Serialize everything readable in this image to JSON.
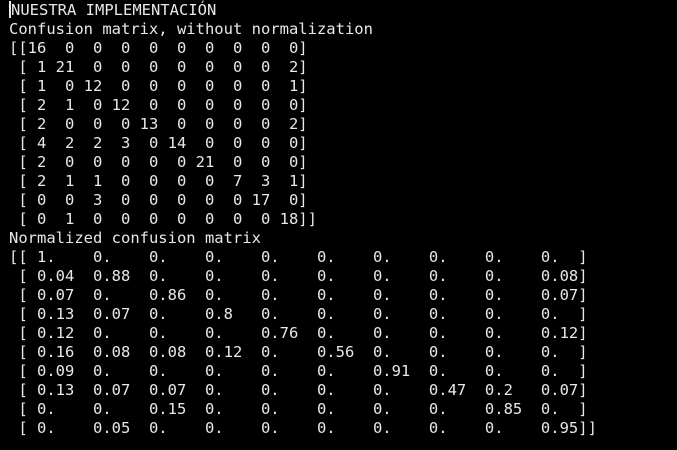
{
  "terminal": {
    "background": "#000000",
    "foreground": "#e8e8e8",
    "lines": [
      "NUESTRA IMPLEMENTACIÓN",
      "Confusion matrix, without normalization",
      "[[16  0  0  0  0  0  0  0  0  0]",
      " [ 1 21  0  0  0  0  0  0  0  2]",
      " [ 1  0 12  0  0  0  0  0  0  1]",
      " [ 2  1  0 12  0  0  0  0  0  0]",
      " [ 2  0  0  0 13  0  0  0  0  2]",
      " [ 4  2  2  3  0 14  0  0  0  0]",
      " [ 2  0  0  0  0  0 21  0  0  0]",
      " [ 2  1  1  0  0  0  0  7  3  1]",
      " [ 0  0  3  0  0  0  0  0 17  0]",
      " [ 0  1  0  0  0  0  0  0  0 18]]",
      "Normalized confusion matrix",
      "[[ 1.    0.    0.    0.    0.    0.    0.    0.    0.    0.  ]",
      " [ 0.04  0.88  0.    0.    0.    0.    0.    0.    0.    0.08]",
      " [ 0.07  0.    0.86  0.    0.    0.    0.    0.    0.    0.07]",
      " [ 0.13  0.07  0.    0.8   0.    0.    0.    0.    0.    0.  ]",
      " [ 0.12  0.    0.    0.    0.76  0.    0.    0.    0.    0.12]",
      " [ 0.16  0.08  0.08  0.12  0.    0.56  0.    0.    0.    0.  ]",
      " [ 0.09  0.    0.    0.    0.    0.    0.91  0.    0.    0.  ]",
      " [ 0.13  0.07  0.07  0.    0.    0.    0.    0.47  0.2   0.07]",
      " [ 0.    0.    0.15  0.    0.    0.    0.    0.    0.85  0.  ]",
      " [ 0.    0.05  0.    0.    0.    0.    0.    0.    0.    0.95]]"
    ]
  }
}
